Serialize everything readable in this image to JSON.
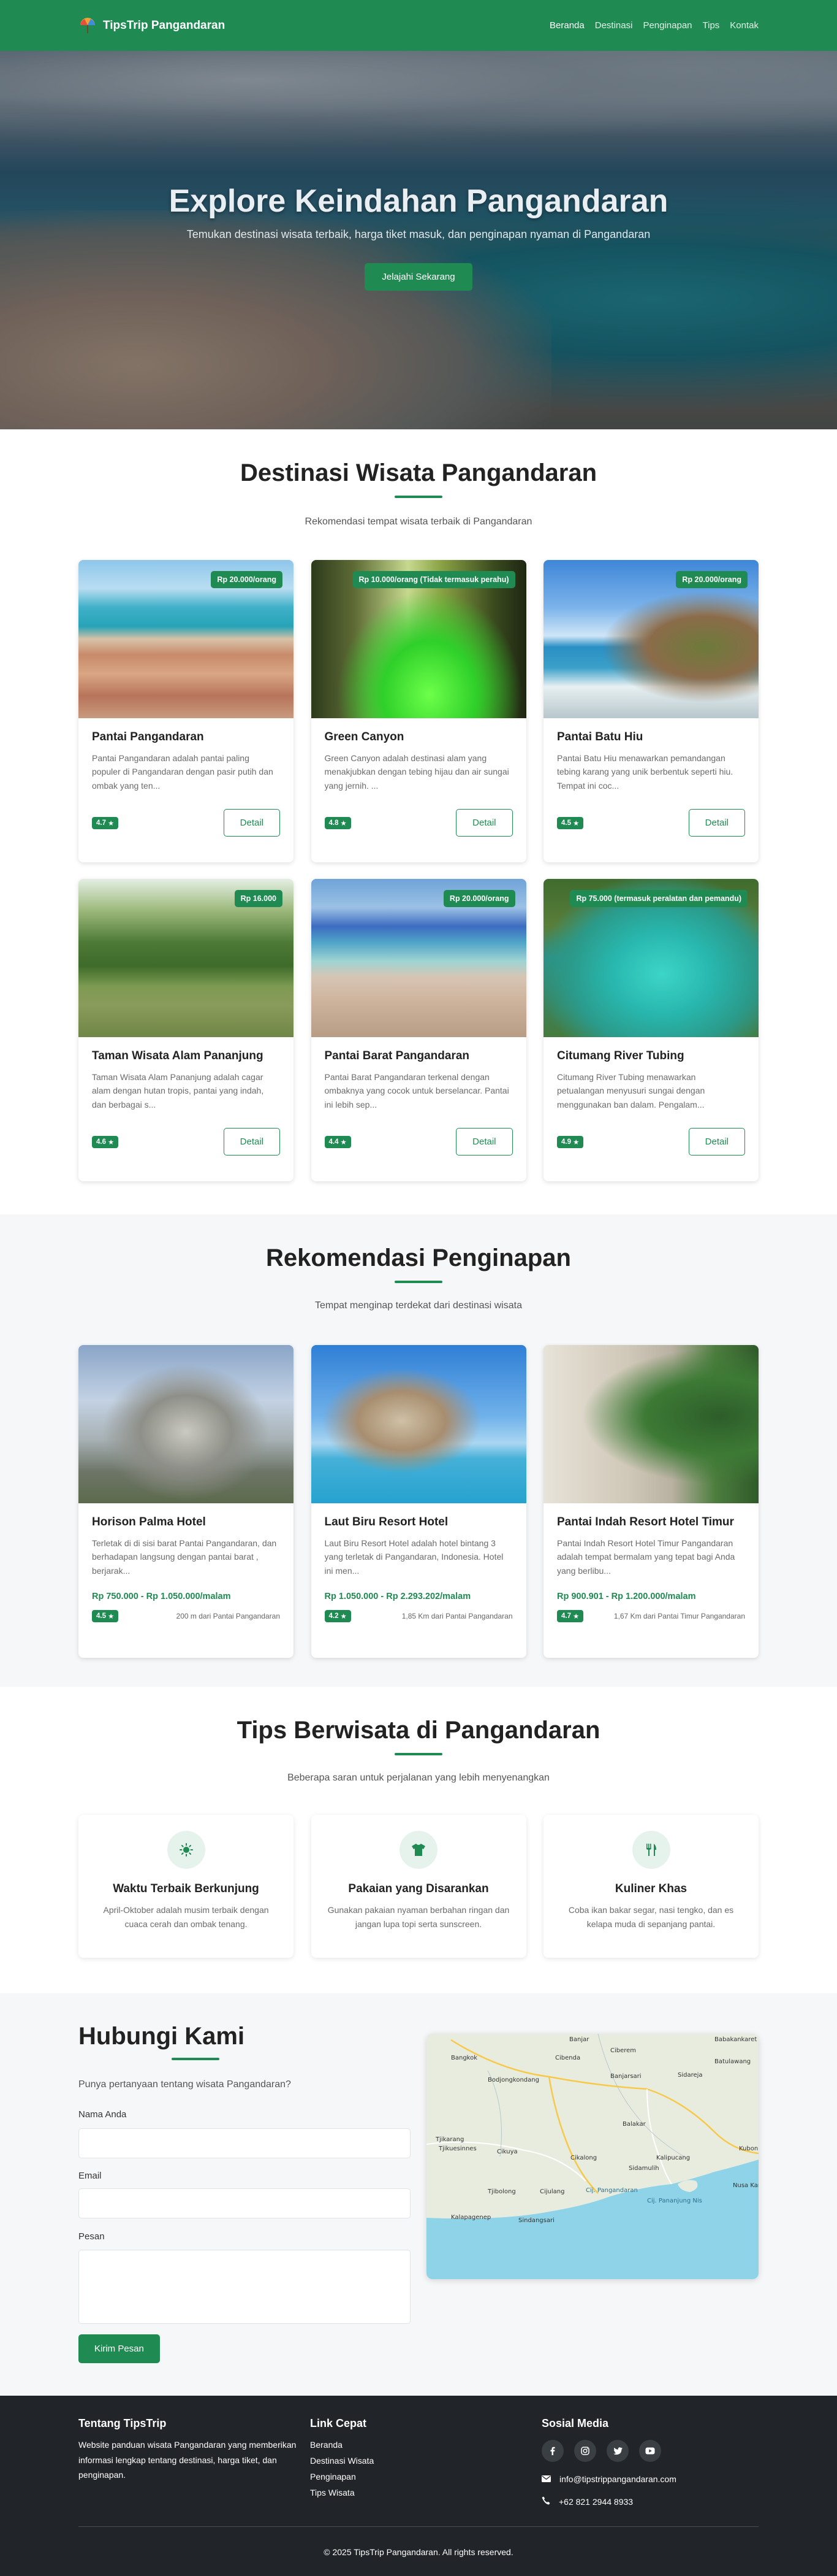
{
  "nav": {
    "brand": "TipsTrip Pangandaran",
    "links": [
      "Beranda",
      "Destinasi",
      "Penginapan",
      "Tips",
      "Kontak"
    ]
  },
  "hero": {
    "title": "Explore Keindahan Pangandaran",
    "subtitle": "Temukan destinasi wisata terbaik, harga tiket masuk, dan penginapan nyaman di Pangandaran",
    "cta": "Jelajahi Sekarang"
  },
  "destinations": {
    "title": "Destinasi Wisata Pangandaran",
    "subtitle": "Rekomendasi tempat wisata terbaik di Pangandaran",
    "detail_label": "Detail",
    "items": [
      {
        "name": "Pantai Pangandaran",
        "price": "Rp 20.000/orang",
        "desc": "Pantai Pangandaran adalah pantai paling populer di Pangandaran dengan pasir putih dan ombak yang ten...",
        "rating": "4.7"
      },
      {
        "name": "Green Canyon",
        "price": "Rp 10.000/orang (Tidak termasuk perahu)",
        "desc": "Green Canyon adalah destinasi alam yang menakjubkan dengan tebing hijau dan air sungai yang jernih. ...",
        "rating": "4.8"
      },
      {
        "name": "Pantai Batu Hiu",
        "price": "Rp 20.000/orang",
        "desc": "Pantai Batu Hiu menawarkan pemandangan tebing karang yang unik berbentuk seperti hiu. Tempat ini coc...",
        "rating": "4.5"
      },
      {
        "name": "Taman Wisata Alam Pananjung",
        "price": "Rp 16.000",
        "desc": "Taman Wisata Alam Pananjung adalah cagar alam dengan hutan tropis, pantai yang indah, dan berbagai s...",
        "rating": "4.6"
      },
      {
        "name": "Pantai Barat Pangandaran",
        "price": "Rp 20.000/orang",
        "desc": "Pantai Barat Pangandaran terkenal dengan ombaknya yang cocok untuk berselancar. Pantai ini lebih sep...",
        "rating": "4.4"
      },
      {
        "name": "Citumang River Tubing",
        "price": "Rp 75.000 (termasuk peralatan dan pemandu)",
        "desc": "Citumang River Tubing menawarkan petualangan menyusuri sungai dengan menggunakan ban dalam. Pengalam...",
        "rating": "4.9"
      }
    ]
  },
  "hotels": {
    "title": "Rekomendasi Penginapan",
    "subtitle": "Tempat menginap terdekat dari destinasi wisata",
    "items": [
      {
        "name": "Horison Palma Hotel",
        "desc": "Terletak di di sisi barat Pantai Pangandaran, dan berhadapan langsung dengan pantai barat , berjarak...",
        "price": "Rp 750.000 - Rp 1.050.000/malam",
        "rating": "4.5",
        "distance": "200 m dari Pantai Pangandaran"
      },
      {
        "name": "Laut Biru Resort Hotel",
        "desc": "Laut Biru Resort Hotel adalah hotel bintang 3 yang terletak di Pangandaran, Indonesia. Hotel ini men...",
        "price": "Rp 1.050.000 - Rp 2.293.202/malam",
        "rating": "4.2",
        "distance": "1,85 Km dari Pantai Pangandaran"
      },
      {
        "name": "Pantai Indah Resort Hotel Timur",
        "desc": "Pantai Indah Resort Hotel Timur Pangandaran adalah tempat bermalam yang tepat bagi Anda yang berlibu...",
        "price": "Rp 900.901 - Rp 1.200.000/malam",
        "rating": "4.7",
        "distance": "1,67 Km dari Pantai Timur Pangandaran"
      }
    ]
  },
  "tips": {
    "title": "Tips Berwisata di Pangandaran",
    "subtitle": "Beberapa saran untuk perjalanan yang lebih menyenangkan",
    "items": [
      {
        "title": "Waktu Terbaik Berkunjung",
        "desc": "April-Oktober adalah musim terbaik dengan cuaca cerah dan ombak tenang.",
        "icon": "sun-icon"
      },
      {
        "title": "Pakaian yang Disarankan",
        "desc": "Gunakan pakaian nyaman berbahan ringan dan jangan lupa topi serta sunscreen.",
        "icon": "shirt-icon"
      },
      {
        "title": "Kuliner Khas",
        "desc": "Coba ikan bakar segar, nasi tengko, dan es kelapa muda di sepanjang pantai.",
        "icon": "utensils-icon"
      }
    ]
  },
  "contact": {
    "title": "Hubungi Kami",
    "question": "Punya pertanyaan tentang wisata Pangandaran?",
    "name_label": "Nama Anda",
    "email_label": "Email",
    "message_label": "Pesan",
    "submit": "Kirim Pesan",
    "map_labels": [
      "Banjar",
      "Babakankaret",
      "Ciberem",
      "Bangkok",
      "Cibenda",
      "Bodjongkondang",
      "Banjarsari",
      "Sidareja",
      "Batulawang",
      "Tjikarang",
      "Balakar",
      "Tjikuesinnes",
      "Cikuya",
      "Cikalong",
      "Kalipucang",
      "Kubon",
      "Sidamulih",
      "Tjibolong",
      "Cijulang",
      "Cij. Pangandaran",
      "Cij. Pananjung Nis",
      "Nusa Kambang",
      "Kalapagenep",
      "Sindangsari"
    ]
  },
  "footer": {
    "about_title": "Tentang TipsTrip",
    "about_text": "Website panduan wisata Pangandaran yang memberikan informasi lengkap tentang destinasi, harga tiket, dan penginapan.",
    "links_title": "Link Cepat",
    "links": [
      "Beranda",
      "Destinasi Wisata",
      "Penginapan",
      "Tips Wisata"
    ],
    "social_title": "Sosial Media",
    "email": "info@tipstrippangandaran.com",
    "phone": "+62 821 2944 8933",
    "copyright": "© 2025 TipsTrip Pangandaran. All rights reserved."
  },
  "colors": {
    "brand": "#1f8a52",
    "footer": "#212529",
    "section_bg": "#f6f7f9"
  }
}
